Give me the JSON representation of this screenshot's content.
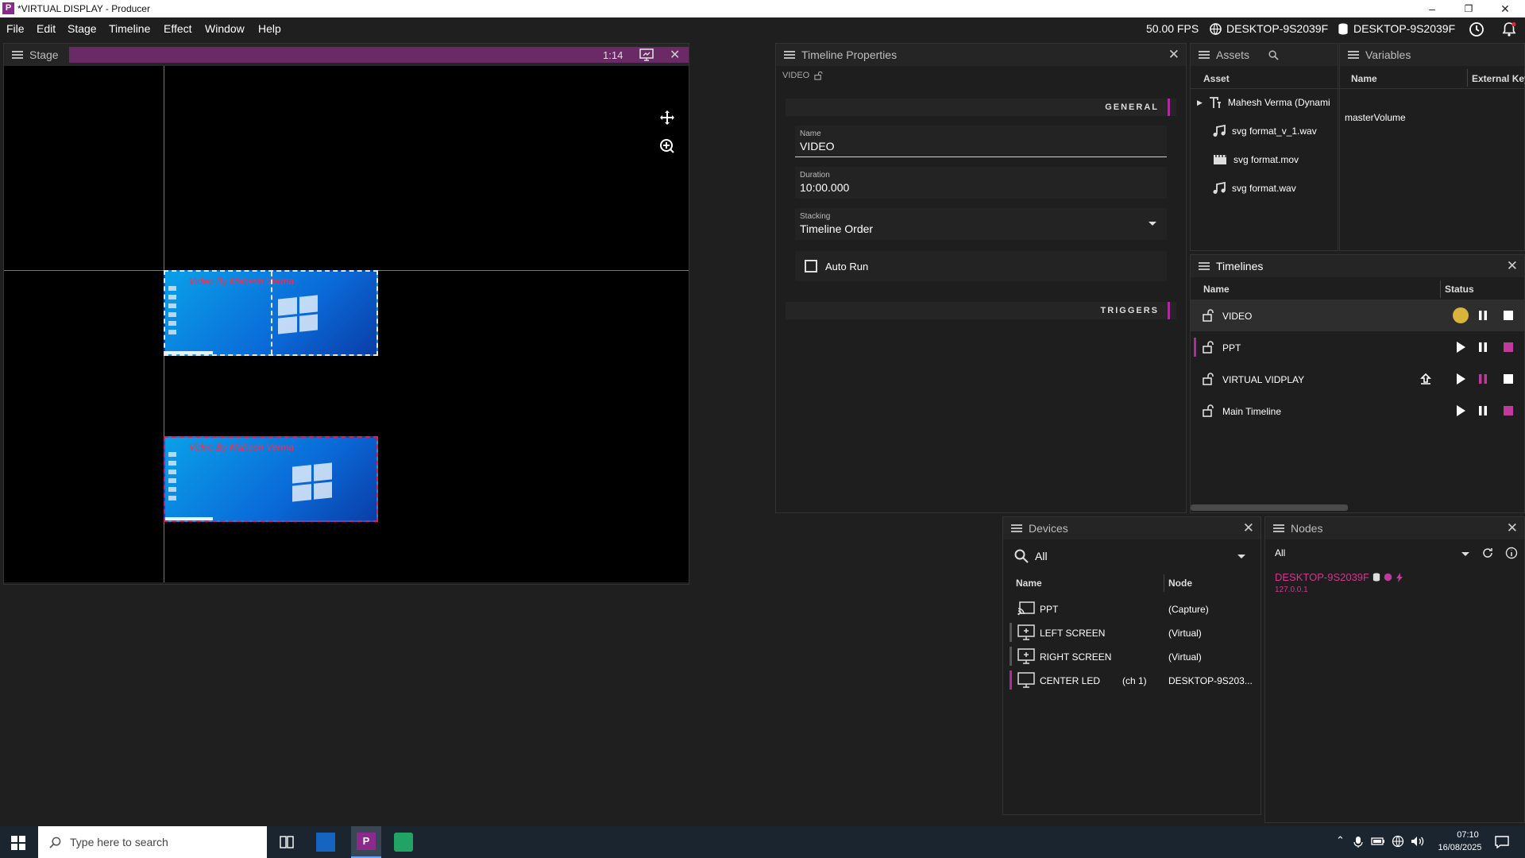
{
  "window": {
    "title": "*VIRTUAL DISPLAY - Producer",
    "logo_letter": "P",
    "min": "–",
    "restore": "❐",
    "close": "✕"
  },
  "menu": [
    "File",
    "Edit",
    "Stage",
    "Timeline",
    "Effect",
    "Window",
    "Help"
  ],
  "status": {
    "fps": "50.00 FPS",
    "host1": "DESKTOP-9S2039F",
    "host2": "DESKTOP-9S2039F"
  },
  "stage": {
    "title": "Stage",
    "zoom": "1:14",
    "accent_color": "#6a2a66",
    "thumb_caption": "Video By Mahesh Verma"
  },
  "timeline_properties": {
    "title": "Timeline Properties",
    "breadcrumb": "VIDEO",
    "general_label": "GENERAL",
    "name_label": "Name",
    "name_value": "VIDEO",
    "duration_label": "Duration",
    "duration_value": "10:00.000",
    "stacking_label": "Stacking",
    "stacking_value": "Timeline Order",
    "autorun_label": "Auto Run",
    "triggers_label": "TRIGGERS"
  },
  "assets": {
    "title": "Assets",
    "column": "Asset",
    "items": [
      {
        "name": "Mahesh Verma (Dynami",
        "icon": "text-icon"
      },
      {
        "name": "svg format_v_1.wav",
        "icon": "music-icon"
      },
      {
        "name": "svg format.mov",
        "icon": "film-icon"
      },
      {
        "name": "svg format.wav",
        "icon": "music-icon"
      }
    ]
  },
  "variables": {
    "title": "Variables",
    "col_name": "Name",
    "col_key": "External Key",
    "items": [
      "masterVolume"
    ]
  },
  "timelines": {
    "title": "Timelines",
    "col_name": "Name",
    "col_status": "Status",
    "rows": [
      "VIDEO",
      "PPT",
      "VIRTUAL VIDPLAY",
      "Main Timeline"
    ]
  },
  "devices": {
    "title": "Devices",
    "filter": "All",
    "col_name": "Name",
    "col_node": "Node",
    "rows": [
      {
        "name": "PPT",
        "channel": "",
        "node": "(Capture)"
      },
      {
        "name": "LEFT SCREEN",
        "channel": "",
        "node": "(Virtual)"
      },
      {
        "name": "RIGHT SCREEN",
        "channel": "",
        "node": "(Virtual)"
      },
      {
        "name": "CENTER LED",
        "channel": "(ch 1)",
        "node": "DESKTOP-9S203..."
      }
    ]
  },
  "nodes": {
    "title": "Nodes",
    "filter": "All",
    "host": "DESKTOP-9S2039F",
    "ip": "127.0.0.1"
  },
  "taskbar": {
    "search_placeholder": "Type here to search",
    "time": "07:10",
    "date": "16/08/2025"
  },
  "colors": {
    "accent": "#b02a9e",
    "bg": "#1e1e1e"
  }
}
